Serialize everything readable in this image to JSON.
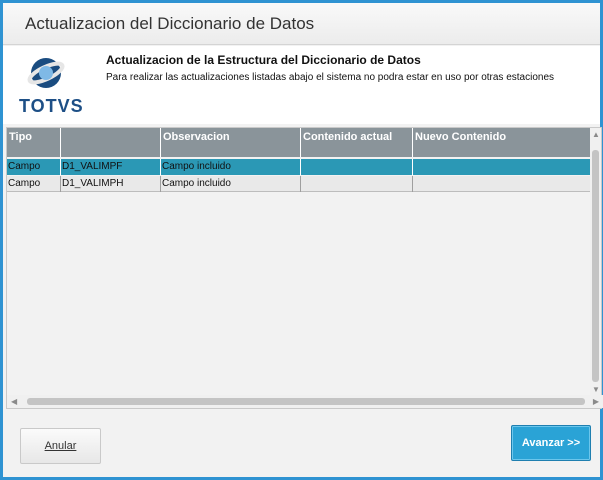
{
  "window": {
    "title": "Actualizacion del Diccionario de Datos"
  },
  "header": {
    "logo_text": "TOTVS",
    "title": "Actualizacion de la Estructura del Diccionario de Datos",
    "description": "Para realizar las actualizaciones listadas abajo el sistema no podra estar en uso por otras estaciones"
  },
  "grid": {
    "columns": [
      "Tipo",
      "",
      "Observacion",
      "Contenido actual",
      "Nuevo Contenido"
    ],
    "rows": [
      {
        "tipo": "Campo",
        "campo": "D1_VALIMPF",
        "observacion": "Campo incluido",
        "contenido_actual": "",
        "nuevo_contenido": "",
        "selected": true
      },
      {
        "tipo": "Campo",
        "campo": "D1_VALIMPH",
        "observacion": "Campo incluido",
        "contenido_actual": "",
        "nuevo_contenido": "",
        "selected": false
      }
    ]
  },
  "buttons": {
    "anular": "Anular",
    "avanzar": "Avanzar >>"
  },
  "colors": {
    "window_border": "#2f93d2",
    "grid_header": "#8a949a",
    "selected_row": "#2b98b5",
    "primary_button": "#2aa3d6"
  }
}
